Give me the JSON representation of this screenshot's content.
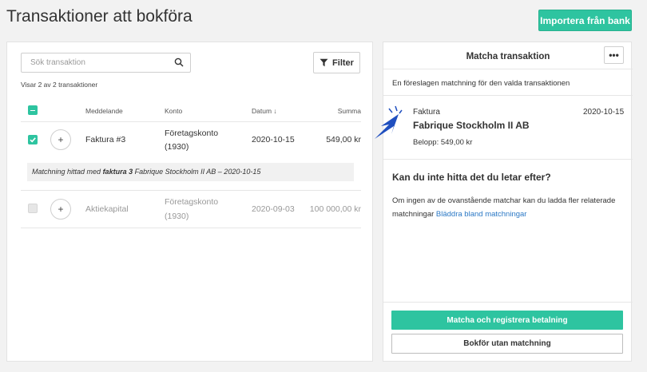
{
  "header": {
    "title": "Transaktioner att bokföra",
    "import_button": "Importera från bank"
  },
  "left": {
    "search_placeholder": "Sök transaktion",
    "filter_label": "Filter",
    "count_text": "Visar 2 av 2 transaktioner",
    "columns": {
      "message": "Meddelande",
      "account": "Konto",
      "date": "Datum ↓",
      "sum": "Summa"
    },
    "rows": [
      {
        "message": "Faktura #3",
        "account_name": "Företagskonto",
        "account_number": "(1930)",
        "date": "2020-10-15",
        "sum": "549,00 kr",
        "selected": true
      },
      {
        "message": "Aktiekapital",
        "account_name": "Företagskonto",
        "account_number": "(1930)",
        "date": "2020-09-03",
        "sum": "100 000,00 kr",
        "selected": false
      }
    ],
    "match_info": {
      "prefix": "Matchning hittad med ",
      "invoice": "faktura 3",
      "rest": " Fabrique Stockholm II AB – 2020-10-15"
    }
  },
  "right": {
    "title": "Matcha transaktion",
    "more_label": "•••",
    "suggested_text": "En föreslagen matchning för den valda transaktionen",
    "match": {
      "type": "Faktura",
      "date": "2020-10-15",
      "name": "Fabrique Stockholm II AB",
      "amount": "Belopp: 549,00 kr"
    },
    "help_title": "Kan du inte hitta det du letar efter?",
    "help_text": "Om ingen av de ovanstående matchar kan du ladda fler relaterade matchningar ",
    "help_link": "Bläddra bland matchningar",
    "primary_button": "Matcha och registrera betalning",
    "secondary_button": "Bokför utan matchning"
  },
  "colors": {
    "accent": "#2ec4a0",
    "link": "#2a78c5",
    "cursor": "#1f4fbf"
  },
  "icons": [
    "search-icon",
    "filter-icon",
    "check-icon",
    "plus-icon",
    "more-icon",
    "arrow-cursor-icon"
  ]
}
